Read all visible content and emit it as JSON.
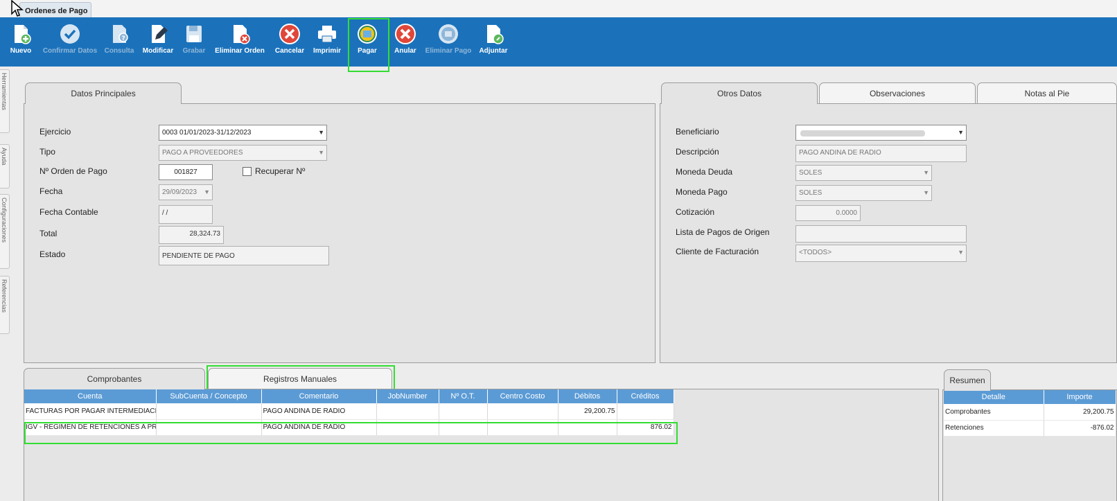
{
  "window": {
    "tab_title": "Ordenes de Pago"
  },
  "toolbar": {
    "nuevo": "Nuevo",
    "confirmar_datos": "Confirmar Datos",
    "consulta": "Consulta",
    "modificar": "Modificar",
    "grabar": "Grabar",
    "eliminar_orden": "Eliminar Orden",
    "cancelar": "Cancelar",
    "imprimir": "Imprimir",
    "pagar": "Pagar",
    "anular": "Anular",
    "eliminar_pago": "Eliminar Pago",
    "adjuntar": "Adjuntar"
  },
  "side_tabs": [
    "Herramientas",
    "Ayuda",
    "Configuraciones",
    "Referencias"
  ],
  "principal": {
    "tab": "Datos Principales",
    "ejercicio_label": "Ejercicio",
    "ejercicio_value": "0003 01/01/2023-31/12/2023",
    "tipo_label": "Tipo",
    "tipo_value": "PAGO A PROVEEDORES",
    "orden_label": "Nº Orden de Pago",
    "orden_value": "001827",
    "recuperar_label": "Recuperar Nº",
    "fecha_label": "Fecha",
    "fecha_value": "29/09/2023",
    "fecha_contable_label": "Fecha Contable",
    "fecha_contable_value": "/ /",
    "total_label": "Total",
    "total_value": "28,324.73",
    "estado_label": "Estado",
    "estado_value": "PENDIENTE DE PAGO"
  },
  "otros": {
    "tabs": [
      "Otros Datos",
      "Observaciones",
      "Notas al Pie"
    ],
    "beneficiario_label": "Beneficiario",
    "descripcion_label": "Descripción",
    "descripcion_value": "PAGO ANDINA DE RADIO",
    "moneda_deuda_label": "Moneda Deuda",
    "moneda_deuda_value": "SOLES",
    "moneda_pago_label": "Moneda Pago",
    "moneda_pago_value": "SOLES",
    "cotizacion_label": "Cotización",
    "cotizacion_value": "0.0000",
    "lista_pagos_label": "Lista de Pagos de Origen",
    "cliente_label": "Cliente de Facturación",
    "cliente_value": "<TODOS>"
  },
  "detalle": {
    "tabs": [
      "Comprobantes",
      "Registros Manuales"
    ],
    "columns": [
      "Cuenta",
      "SubCuenta / Concepto",
      "Comentario",
      "JobNumber",
      "Nº O.T.",
      "Centro Costo",
      "Débitos",
      "Créditos"
    ],
    "rows": [
      [
        "FACTURAS POR PAGAR INTERMEDIACIÓN",
        "",
        "PAGO ANDINA DE RADIO",
        "",
        "",
        "",
        "29,200.75",
        ""
      ],
      [
        "IGV - REGIMEN DE RETENCIONES A PROVEEDORES",
        "",
        "PAGO ANDINA DE RADIO",
        "",
        "",
        "",
        "",
        "876.02"
      ]
    ]
  },
  "resumen": {
    "tab": "Resumen",
    "columns": [
      "Detalle",
      "Importe"
    ],
    "rows": [
      [
        "Comprobantes",
        "29,200.75"
      ],
      [
        "Retenciones",
        "-876.02"
      ]
    ]
  },
  "colors": {
    "toolbar": "#1b72bb",
    "highlight": "#33dd33",
    "table_header": "#5b9bd5"
  }
}
